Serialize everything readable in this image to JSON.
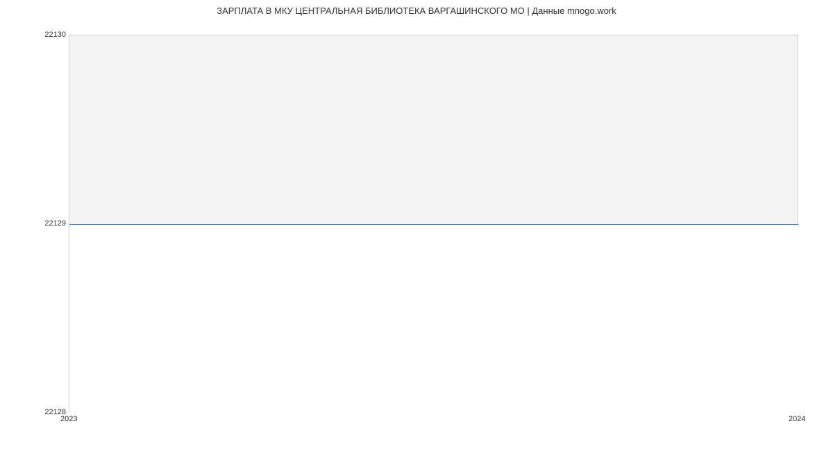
{
  "chart_data": {
    "type": "line",
    "title": "ЗАРПЛАТА В МКУ ЦЕНТРАЛЬНАЯ БИБЛИОТЕКА ВАРГАШИНСКОГО МО | Данные mnogo.work",
    "x": [
      2023,
      2024
    ],
    "values": [
      22129,
      22129
    ],
    "xlabel": "",
    "ylabel": "",
    "xlim": [
      2023,
      2024
    ],
    "ylim": [
      22128,
      22130
    ],
    "yticks": [
      22128,
      22129,
      22130
    ],
    "xticks": [
      2023,
      2024
    ]
  }
}
